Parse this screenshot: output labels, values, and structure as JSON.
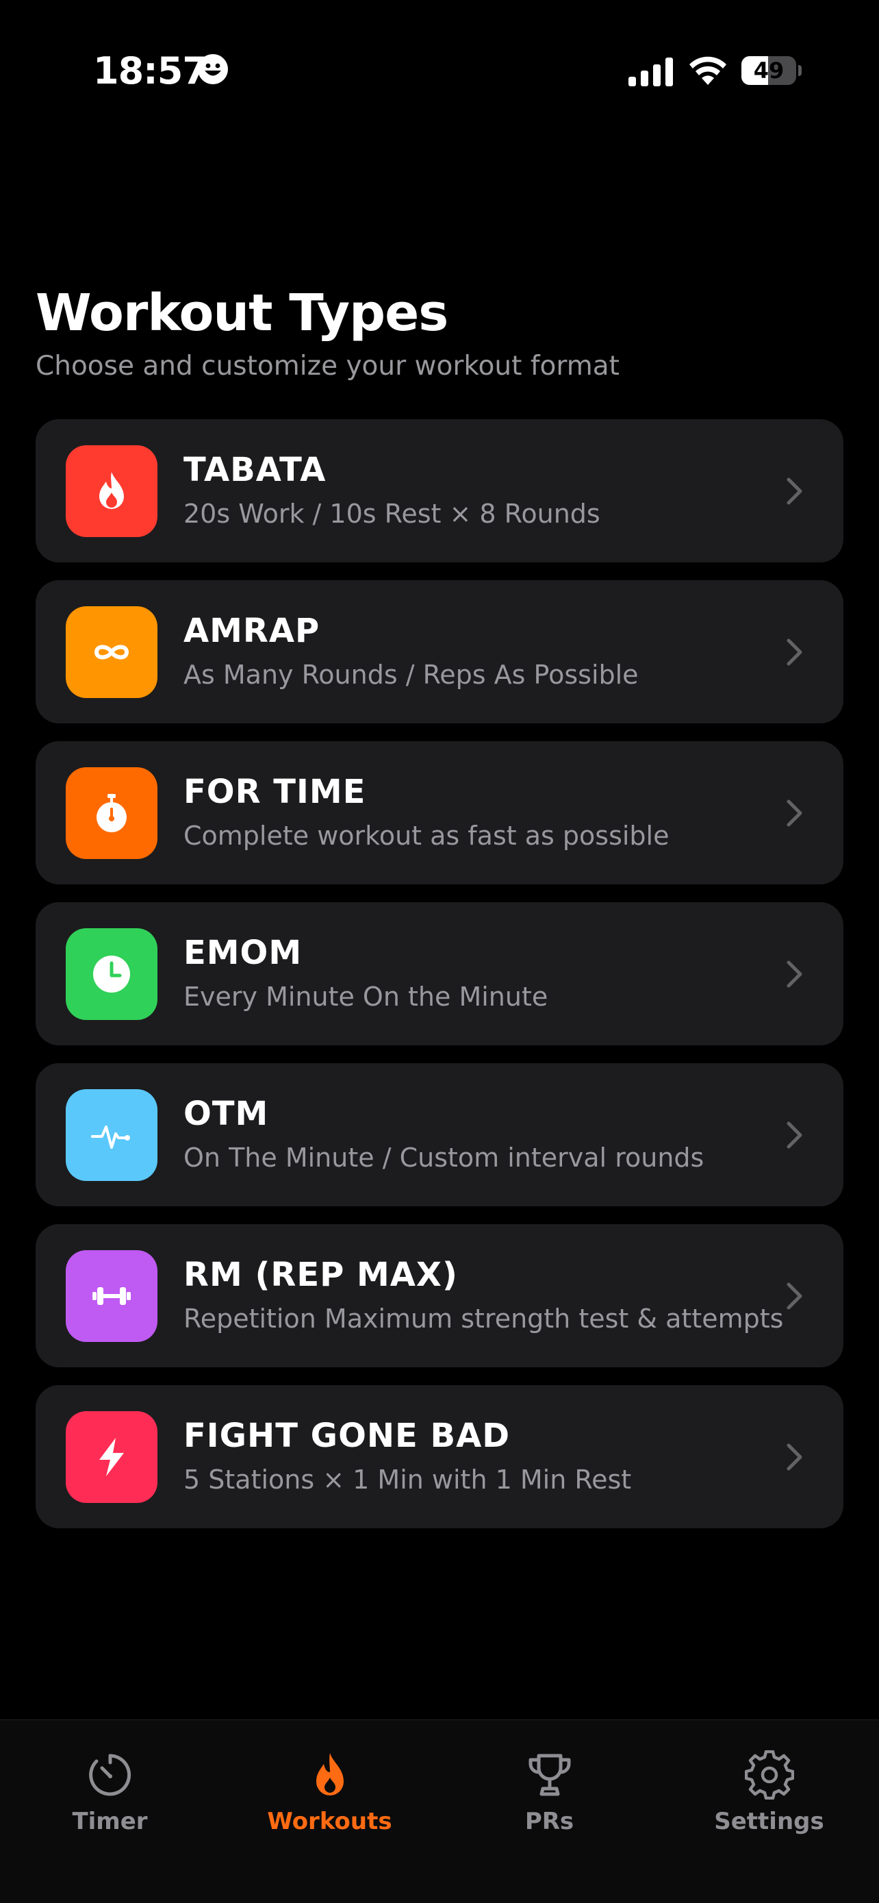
{
  "status_bar": {
    "time": "18:57",
    "battery": "49",
    "battery_level": 0.49
  },
  "header": {
    "title": "Workout Types",
    "subtitle": "Choose and customize your workout format"
  },
  "workouts": [
    {
      "title": "TABATA",
      "description": "20s Work / 10s Rest × 8 Rounds",
      "icon": "flame-icon",
      "color": "#ff3b30"
    },
    {
      "title": "AMRAP",
      "description": "As Many Rounds / Reps As Possible",
      "icon": "infinity-icon",
      "color": "#ff9500"
    },
    {
      "title": "FOR TIME",
      "description": "Complete workout as fast as possible",
      "icon": "stopwatch-icon",
      "color": "#ff6a00"
    },
    {
      "title": "EMOM",
      "description": "Every Minute On the Minute",
      "icon": "clock-icon",
      "color": "#30d158"
    },
    {
      "title": "OTM",
      "description": "On The Minute / Custom interval rounds",
      "icon": "heartbeat-icon",
      "color": "#5ac8fa"
    },
    {
      "title": "RM (REP MAX)",
      "description": "Repetition Maximum strength test & attempts",
      "icon": "dumbbell-icon",
      "color": "#bf5af2"
    },
    {
      "title": "FIGHT GONE BAD",
      "description": "5 Stations × 1 Min with 1 Min Rest",
      "icon": "bolt-icon",
      "color": "#ff2d55"
    }
  ],
  "tab_bar": {
    "accent": "#ff6b12",
    "inactive": "#8e8e93",
    "tabs": [
      {
        "label": "Timer",
        "icon": "timer-icon",
        "active": false
      },
      {
        "label": "Workouts",
        "icon": "flame-icon",
        "active": true
      },
      {
        "label": "PRs",
        "icon": "trophy-icon",
        "active": false
      },
      {
        "label": "Settings",
        "icon": "gear-icon",
        "active": false
      }
    ]
  }
}
